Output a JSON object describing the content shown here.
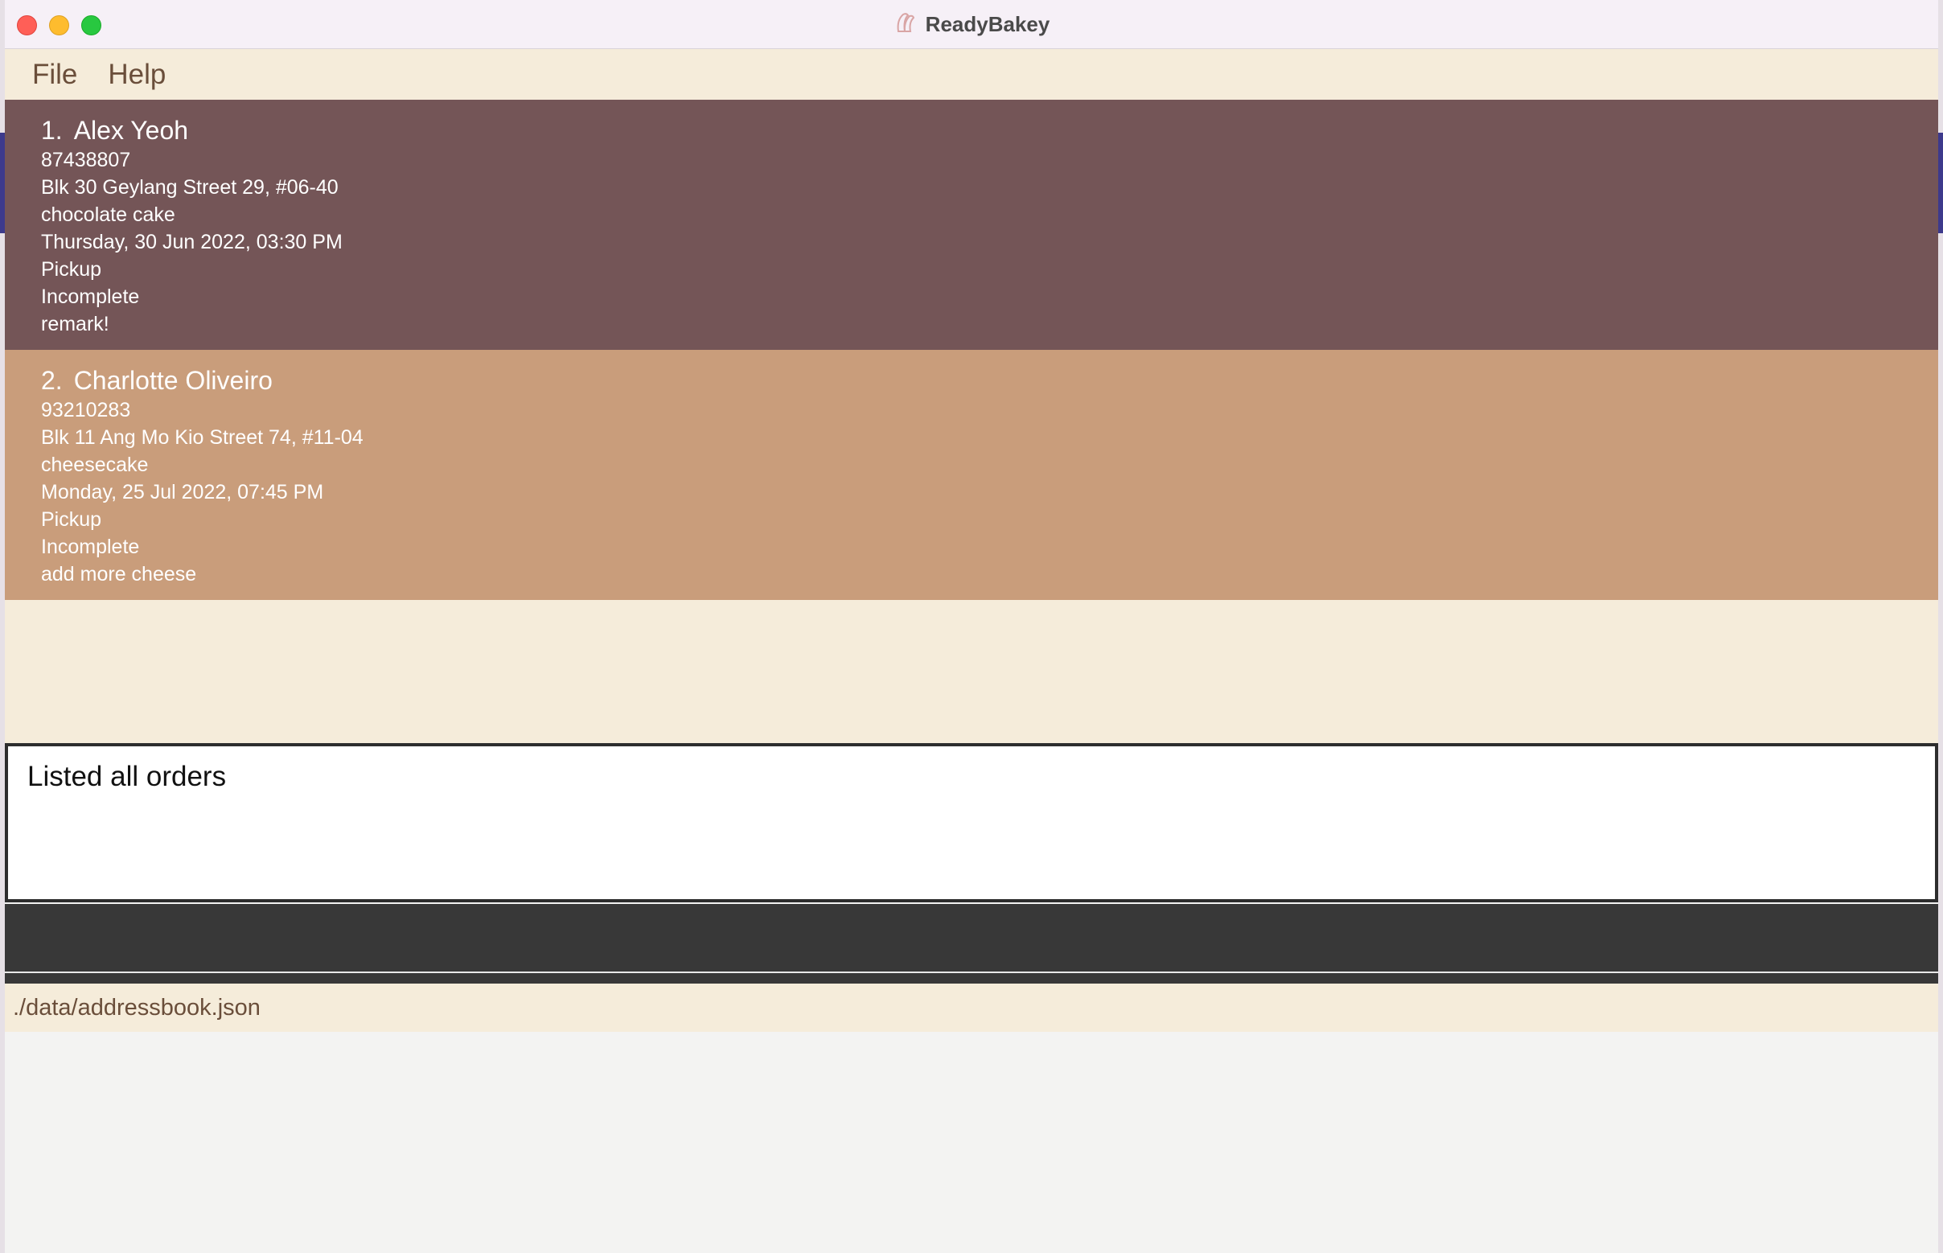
{
  "window": {
    "title": "ReadyBakey",
    "app_icon": "readybakey-logo-icon"
  },
  "menubar": {
    "items": [
      {
        "label": "File"
      },
      {
        "label": "Help"
      }
    ]
  },
  "orders": [
    {
      "index": "1.",
      "name": "Alex Yeoh",
      "phone": "87438807",
      "address": "Blk 30 Geylang Street 29, #06-40",
      "item": "chocolate cake",
      "datetime": "Thursday, 30 Jun 2022, 03:30 PM",
      "delivery_method": "Pickup",
      "status": "Incomplete",
      "remark": "remark!",
      "card_color": "#745557"
    },
    {
      "index": "2.",
      "name": "Charlotte Oliveiro",
      "phone": "93210283",
      "address": "Blk 11 Ang Mo Kio Street 74, #11-04",
      "item": "cheesecake",
      "datetime": "Monday, 25 Jul 2022, 07:45 PM",
      "delivery_method": "Pickup",
      "status": "Incomplete",
      "remark": "add more cheese",
      "card_color": "#c99d7b"
    }
  ],
  "result_display": {
    "text": "Listed all orders"
  },
  "command_box": {
    "value": "",
    "placeholder": ""
  },
  "status_bar": {
    "save_location": "./data/addressbook.json"
  },
  "colors": {
    "menubar_bg": "#f5ecda",
    "card_odd": "#745557",
    "card_even": "#c99d7b",
    "command_bg": "#383838",
    "menu_text": "#6a4e3a"
  }
}
